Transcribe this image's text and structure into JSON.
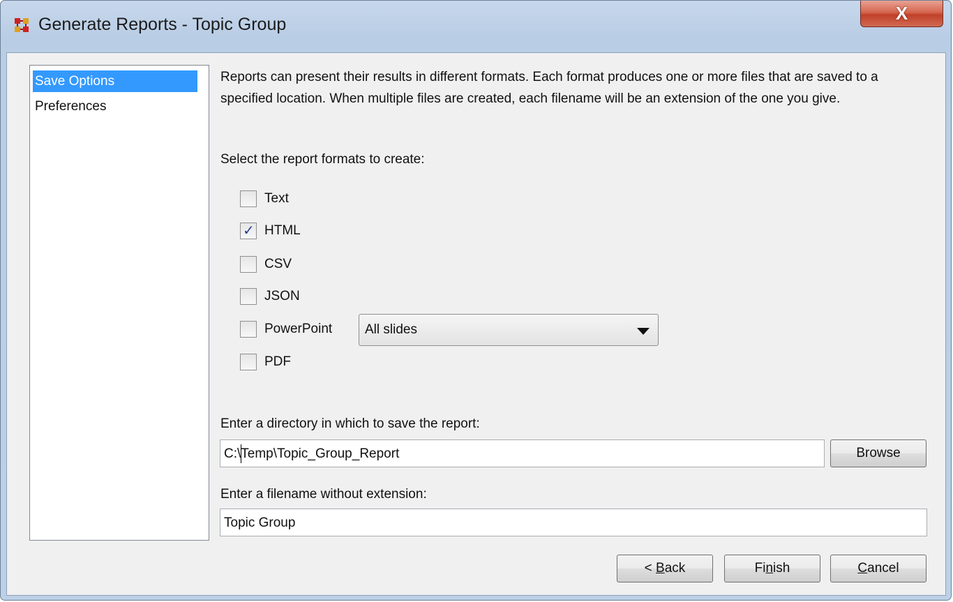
{
  "window": {
    "title": "Generate Reports - Topic Group",
    "close_label": "X"
  },
  "sidebar": {
    "items": [
      {
        "label": "Save Options",
        "selected": true
      },
      {
        "label": "Preferences",
        "selected": false
      }
    ]
  },
  "main": {
    "description": "Reports can present their results in different formats. Each format produces one or more files that are saved to a specified location. When multiple files are created, each filename will be an extension of the one you give.",
    "formats_label": "Select the report formats to create:",
    "formats": [
      {
        "label": "Text",
        "checked": false
      },
      {
        "label": "HTML",
        "checked": true
      },
      {
        "label": "CSV",
        "checked": false
      },
      {
        "label": "JSON",
        "checked": false
      },
      {
        "label": "PowerPoint",
        "checked": false
      },
      {
        "label": "PDF",
        "checked": false
      }
    ],
    "powerpoint_option": "All slides",
    "directory_label": "Enter a directory in which to save the report:",
    "directory_value": "C:\\Temp\\Topic_Group_Report",
    "browse_label": "Browse",
    "filename_label": "Enter a filename without extension:",
    "filename_value": "Topic Group"
  },
  "footer": {
    "back_prefix": "< ",
    "back_mnemonic": "B",
    "back_rest": "ack",
    "finish_prefix": "Fi",
    "finish_mnemonic": "n",
    "finish_rest": "ish",
    "cancel_mnemonic": "C",
    "cancel_rest": "ancel"
  },
  "colors": {
    "selection": "#3399ff",
    "close_button": "#c9452e",
    "window_frame": "#bcd0e7",
    "dialog_background": "#f0f0f0"
  }
}
